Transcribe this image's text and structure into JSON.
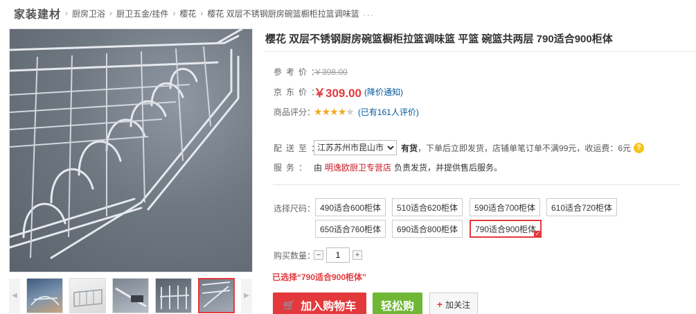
{
  "breadcrumb": {
    "root": "家装建材",
    "items": [
      "厨房卫浴",
      "厨卫五金/挂件",
      "樱花",
      "樱花 双层不锈钢厨房碗篮橱柜拉篮调味篮"
    ],
    "ellipsis": "..."
  },
  "product": {
    "title": "樱花 双层不锈钢厨房碗篮橱柜拉篮调味篮 平篮 碗篮共两层 790适合900柜体"
  },
  "price": {
    "ref_label": "参考价：",
    "ref_value": "￥398.00",
    "jd_label": "京东价：",
    "jd_value": "￥309.00",
    "notice": "(降价通知)"
  },
  "rating": {
    "label": "商品评分：",
    "stars": 4,
    "stars_max": 5,
    "reviews": "(已有161人评价)"
  },
  "delivery": {
    "label": "配送至：",
    "area": "江苏苏州市昆山市",
    "stock": "有货",
    "note": "，下单后立即发货，店铺单笔订单不满99元，收运费：6元"
  },
  "service": {
    "label": "服务：",
    "prefix": "由",
    "shop": "明逸欧厨卫专营店",
    "suffix": "负责发货，并提供售后服务。"
  },
  "sizes": {
    "label": "选择尺码：",
    "options": [
      "490适合600柜体",
      "510适合620柜体",
      "590适合700柜体",
      "610适合720柜体",
      "650适合760柜体",
      "690适合800柜体",
      "790适合900柜体"
    ],
    "selected_index": 6
  },
  "quantity": {
    "label": "购买数量：",
    "minus": "−",
    "value": "1",
    "plus": "+"
  },
  "chosen": "已选择“790适合900柜体”",
  "buttons": {
    "cart": "加入购物车",
    "easy": "轻松购",
    "follow": "加关注"
  },
  "icons": {
    "cart": "cart-icon",
    "help": "question-icon",
    "prev": "chevron-left-icon",
    "next": "chevron-right-icon",
    "follow": "plus-icon"
  },
  "colors": {
    "accent": "#e4393c",
    "link": "#005aa0",
    "green": "#6fb735",
    "star": "#f4a91a"
  }
}
